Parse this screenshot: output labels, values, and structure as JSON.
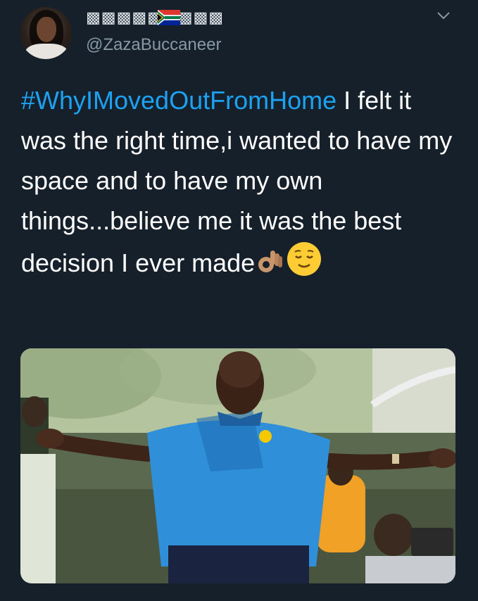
{
  "tweet": {
    "display_name": "▩▩▩▩▩▩▩▩▩",
    "handle": "@ZazaBuccaneer",
    "text": {
      "hashtag": "#WhyIMovedOutFromHome",
      "body": " I felt it was the right time,i wanted to have my space and to have my own things...believe me it was the best decision I ever made"
    },
    "emojis": [
      "ok-hand-emoji",
      "relieved-face-emoji"
    ]
  },
  "colors": {
    "background": "#15202b",
    "hashtag": "#1da1f2",
    "handle": "#8899a6",
    "text": "#ffffff"
  },
  "icons": {
    "flag": "south-africa-flag-icon",
    "menu": "chevron-down-icon"
  }
}
